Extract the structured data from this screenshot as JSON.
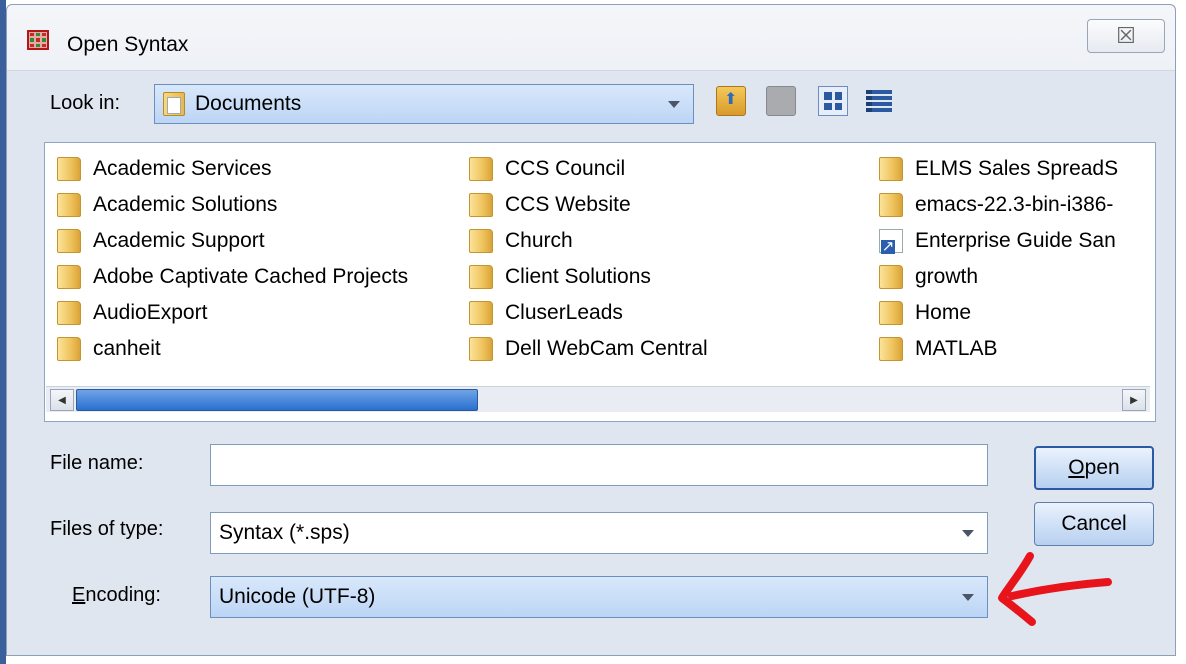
{
  "dialog": {
    "title": "Open Syntax",
    "close_glyph": "☒"
  },
  "lookin": {
    "label": "Look in:",
    "value": "Documents"
  },
  "toolbar": {
    "icons": [
      "up-folder-icon",
      "new-folder-icon",
      "list-view-icon",
      "details-view-icon"
    ]
  },
  "files": {
    "col1": [
      {
        "name": "Academic Services",
        "type": "folder"
      },
      {
        "name": "Academic Solutions",
        "type": "folder"
      },
      {
        "name": "Academic Support",
        "type": "folder"
      },
      {
        "name": "Adobe Captivate Cached Projects",
        "type": "folder"
      },
      {
        "name": "AudioExport",
        "type": "folder"
      },
      {
        "name": "canheit",
        "type": "folder"
      }
    ],
    "col2": [
      {
        "name": "CCS Council",
        "type": "folder"
      },
      {
        "name": "CCS Website",
        "type": "folder"
      },
      {
        "name": "Church",
        "type": "folder"
      },
      {
        "name": "Client Solutions",
        "type": "folder"
      },
      {
        "name": "CluserLeads",
        "type": "folder"
      },
      {
        "name": "Dell WebCam Central",
        "type": "folder"
      }
    ],
    "col3": [
      {
        "name": "ELMS Sales SpreadS",
        "type": "folder"
      },
      {
        "name": "emacs-22.3-bin-i386-",
        "type": "folder"
      },
      {
        "name": "Enterprise Guide San",
        "type": "shortcut"
      },
      {
        "name": "growth",
        "type": "folder"
      },
      {
        "name": "Home",
        "type": "folder"
      },
      {
        "name": "MATLAB",
        "type": "folder"
      }
    ]
  },
  "filename": {
    "label": "File name:",
    "value": ""
  },
  "filetype": {
    "label": "Files of type:",
    "value": "Syntax (*.sps)"
  },
  "encoding": {
    "label_underlined": "E",
    "label_rest": "ncoding:",
    "value": "Unicode (UTF-8)"
  },
  "buttons": {
    "open_underlined": "O",
    "open_rest": "pen",
    "cancel": "Cancel"
  },
  "colors": {
    "annotation_arrow": "#e8141b",
    "scroll_thumb": "#2a6fd0"
  }
}
